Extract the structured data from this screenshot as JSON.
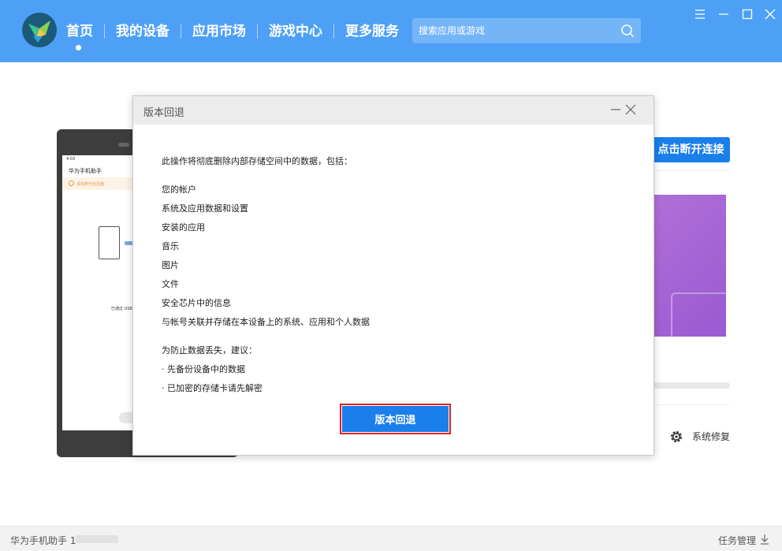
{
  "header": {
    "nav": [
      {
        "label": "首页",
        "active": true
      },
      {
        "label": "我的设备",
        "active": false
      },
      {
        "label": "应用市场",
        "active": false
      },
      {
        "label": "游戏中心",
        "active": false
      },
      {
        "label": "更多服务",
        "active": false
      }
    ],
    "search": {
      "placeholder": "搜索应用或游戏"
    }
  },
  "device_preview": {
    "status": "4:03",
    "app_title": "华为手机助手",
    "warning": "请勿断开此页面",
    "usb_text": "已通过 USB"
  },
  "right_panel": {
    "disconnect_label": "点击断开连接",
    "repair_label": "系统修复"
  },
  "dialog": {
    "title": "版本回退",
    "intro": "此操作将彻底删除内部存储空间中的数据，包括：",
    "items": [
      "您的帐户",
      "系统及应用数据和设置",
      "安装的应用",
      "音乐",
      "图片",
      "文件",
      "安全芯片中的信息",
      "与帐号关联并存储在本设备上的系统、应用和个人数据"
    ],
    "advice_title": "为防止数据丢失，建议：",
    "advice": [
      "· 先备份设备中的数据",
      "· 已加密的存储卡请先解密"
    ],
    "confirm_label": "版本回退"
  },
  "footer": {
    "app_name": "华为手机助手 1",
    "tasks_label": "任务管理"
  },
  "colors": {
    "header_bg": "#4ea0f6",
    "primary": "#1a7fea",
    "highlight": "#e02020",
    "purple": "#a565d6"
  }
}
